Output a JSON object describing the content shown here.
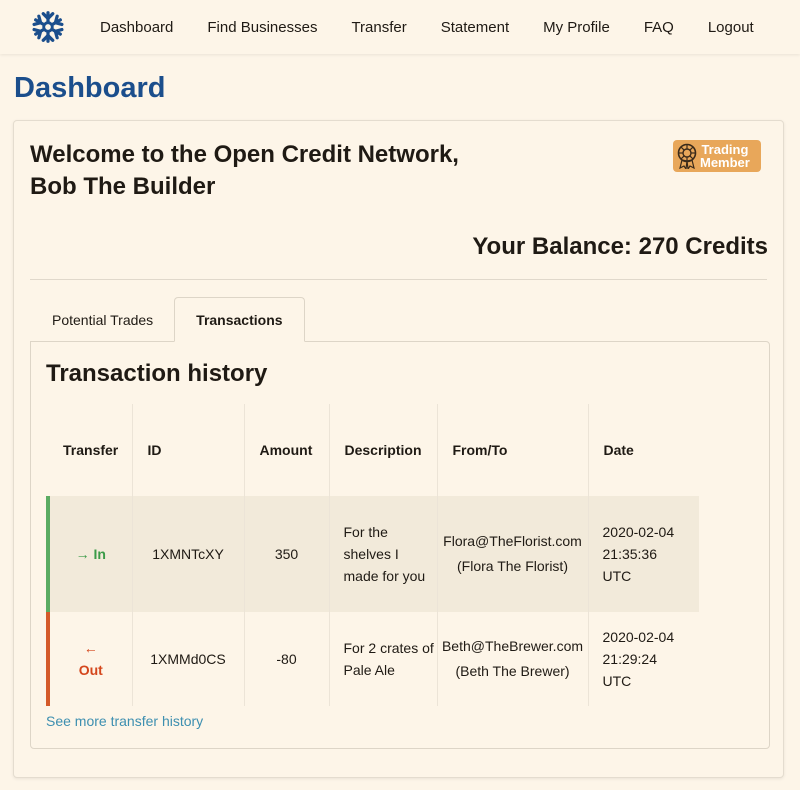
{
  "nav": {
    "items": [
      "Dashboard",
      "Find Businesses",
      "Transfer",
      "Statement",
      "My Profile",
      "FAQ",
      "Logout"
    ]
  },
  "page": {
    "title": "Dashboard"
  },
  "welcome": {
    "line1": "Welcome to the Open Credit Network,",
    "line2": "Bob The Builder"
  },
  "badge": {
    "line1": "Trading",
    "line2": "Member"
  },
  "balance": {
    "text": "Your Balance: 270 Credits"
  },
  "tabs": [
    {
      "label": "Potential Trades",
      "active": false
    },
    {
      "label": "Transactions",
      "active": true
    }
  ],
  "history": {
    "title": "Transaction history",
    "columns": [
      "Transfer",
      "ID",
      "Amount",
      "Description",
      "From/To",
      "Date"
    ],
    "rows": [
      {
        "direction": "In",
        "arrow": "→",
        "id": "1XMNTcXY",
        "amount": "350",
        "description": "For the shelves I made for you",
        "email": "Flora@TheFlorist.com",
        "name": "(Flora The Florist)",
        "date": "2020-02-04",
        "time": "21:35:36",
        "tz": "UTC"
      },
      {
        "direction": "Out",
        "arrow": "←",
        "id": "1XMMd0CS",
        "amount": "-80",
        "description": "For 2 crates of Pale Ale",
        "email": "Beth@TheBrewer.com",
        "name": "(Beth The Brewer)",
        "date": "2020-02-04",
        "time": "21:29:24",
        "tz": "UTC"
      }
    ],
    "more_link": "See more transfer history"
  },
  "colors": {
    "brand_blue": "#1b4e8c",
    "in_green": "#3b9b48",
    "out_red": "#d4461c",
    "badge_orange": "#e8a75a",
    "link": "#3d8fb0"
  }
}
